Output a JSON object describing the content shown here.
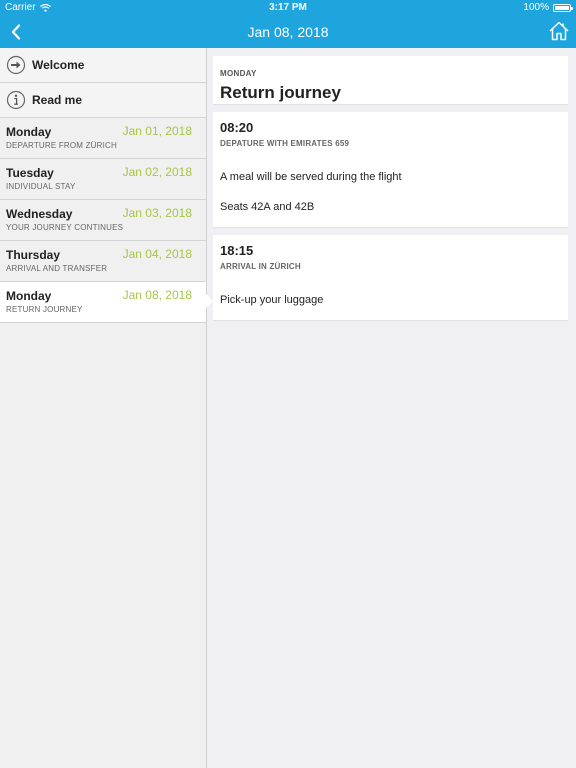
{
  "status_bar": {
    "carrier": "Carrier",
    "time": "3:17 PM",
    "battery": "100%",
    "battery_level": 1.0
  },
  "nav_bar": {
    "title": "Jan 08, 2018",
    "back_icon": "chevron-left-icon",
    "home_icon": "home-icon"
  },
  "sidebar": {
    "menu": [
      {
        "label": "Welcome",
        "icon": "arrow-right-circle-icon"
      },
      {
        "label": "Read me",
        "icon": "info-circle-icon"
      }
    ],
    "days": [
      {
        "day": "Monday",
        "date": "Jan 01, 2018",
        "subtitle": "DEPARTURE FROM ZÜRICH",
        "active": false
      },
      {
        "day": "Tuesday",
        "date": "Jan 02, 2018",
        "subtitle": "INDIVIDUAL STAY",
        "active": false
      },
      {
        "day": "Wednesday",
        "date": "Jan 03, 2018",
        "subtitle": "YOUR JOURNEY CONTINUES",
        "active": false
      },
      {
        "day": "Thursday",
        "date": "Jan 04, 2018",
        "subtitle": "ARRIVAL AND TRANSFER",
        "active": false
      },
      {
        "day": "Monday",
        "date": "Jan 08, 2018",
        "subtitle": "RETURN JOURNEY",
        "active": true
      }
    ]
  },
  "detail": {
    "weekday": "MONDAY",
    "title": "Return journey",
    "events": [
      {
        "time": "08:20",
        "title": "DEPATURE WITH EMIRATES 659",
        "lines": [
          "A meal will be served during the flight",
          "Seats 42A and 42B"
        ]
      },
      {
        "time": "18:15",
        "title": "ARRIVAL IN ZÜRICH",
        "lines": [
          "Pick-up your luggage"
        ]
      }
    ]
  },
  "colors": {
    "accent": "#1ea5de",
    "date_green": "#a6c648"
  }
}
